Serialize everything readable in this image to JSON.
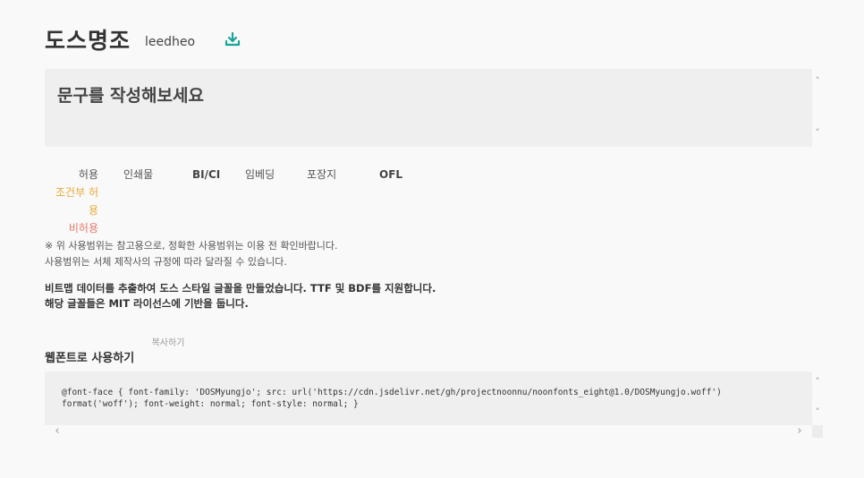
{
  "header": {
    "font_name": "도스명조",
    "author": "leedheo",
    "download_icon": "download-icon",
    "accent_color": "#1aa39a"
  },
  "preview": {
    "placeholder": "문구를 작성해보세요",
    "scroll_up": "˄",
    "scroll_down": "˅"
  },
  "license": {
    "legend": {
      "allow": "허용",
      "conditional": "조건부 허용",
      "deny": "비허용"
    },
    "categories": [
      "인쇄물",
      "BI/CI",
      "임베딩",
      "포장지",
      "OFL"
    ],
    "colors": {
      "allow": "#555555",
      "conditional": "#e8a93a",
      "deny": "#e07b6b"
    }
  },
  "note": {
    "line1": "※ 위 사용범위는 참고용으로, 정확한 사용범위는 이용 전 확인바랍니다.",
    "line2": "사용범위는 서체 제작사의 규정에 따라 달라질 수 있습니다."
  },
  "description": {
    "line1": "비트맵 데이터를 추출하여 도스 스타일 글꼴을 만들었습니다. TTF 및 BDF를 지원합니다.",
    "line2": "해당 글꼴들은 MIT 라이선스에 기반을 둡니다."
  },
  "webfont": {
    "title": "웹폰트로 사용하기",
    "copy_label": "복사하기",
    "code": "@font-face { font-family: 'DOSMyungjo'; src: url('https://cdn.jsdelivr.net/gh/projectnoonnu/noonfonts_eight@1.0/DOSMyungjo.woff') format('woff'); font-weight: normal; font-style: normal; }",
    "scroll_left": "‹",
    "scroll_right": "›",
    "scroll_up": "˄",
    "scroll_down": "˅"
  }
}
